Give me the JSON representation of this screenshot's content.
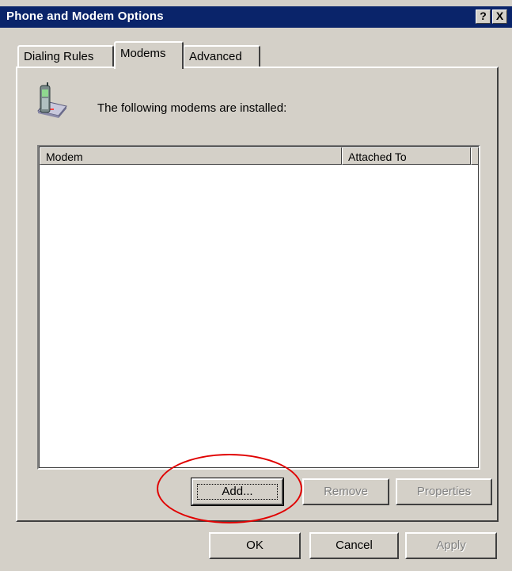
{
  "window": {
    "title": "Phone and Modem Options",
    "help_button": "?",
    "close_button": "X"
  },
  "tabs": [
    {
      "label": "Dialing Rules",
      "active": false
    },
    {
      "label": "Modems",
      "active": true
    },
    {
      "label": "Advanced",
      "active": false
    }
  ],
  "modems_tab": {
    "icon": "modem-phone-icon",
    "installed_text": "The following modems are installed:",
    "columns": [
      "Modem",
      "Attached To"
    ],
    "rows": []
  },
  "panel_buttons": {
    "add": "Add...",
    "remove": "Remove",
    "properties": "Properties"
  },
  "dialog_buttons": {
    "ok": "OK",
    "cancel": "Cancel",
    "apply": "Apply"
  },
  "colors": {
    "titlebar": "#0a246a",
    "face": "#d4d0c8",
    "annotation": "#e00000"
  }
}
